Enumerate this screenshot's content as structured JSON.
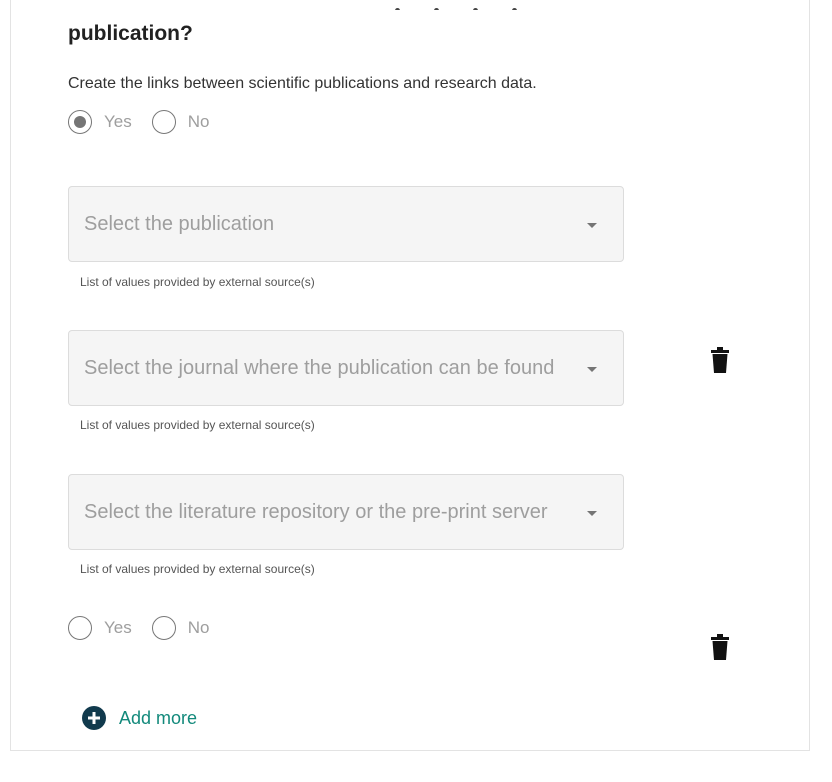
{
  "question": {
    "title": "publication?",
    "description": "Create the links between scientific publications and research data."
  },
  "first_radio": {
    "yes_label": "Yes",
    "no_label": "No",
    "selected": "Yes"
  },
  "selects": [
    {
      "placeholder": "Select the publication",
      "hint": "List of values provided by external source(s)"
    },
    {
      "placeholder": "Select the journal where the publication can be found",
      "hint": "List of values provided by external source(s)"
    },
    {
      "placeholder": "Select the literature repository or the pre-print server",
      "hint": "List of values provided by external source(s)"
    }
  ],
  "second_radio": {
    "yes_label": "Yes",
    "no_label": "No",
    "selected": ""
  },
  "add_more": {
    "label": "Add more"
  },
  "icons": {
    "delete": "trash-icon",
    "add": "plus-circle-icon",
    "dropdown": "caret-down-icon"
  },
  "colors": {
    "accent_teal": "#12897b",
    "add_icon_bg": "#113a4d"
  }
}
